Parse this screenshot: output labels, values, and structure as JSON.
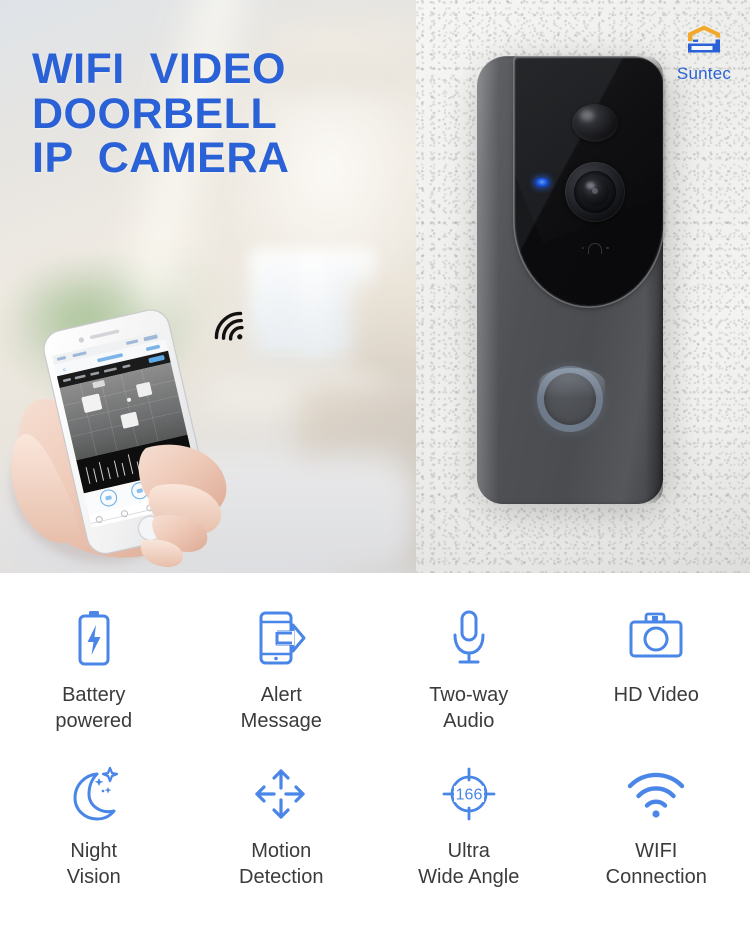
{
  "brand": {
    "name": "Suntec",
    "logo_icon": "house-logo-icon",
    "roof_color": "#f0a92a",
    "base_color": "#2a61d6",
    "text_color": "#2a61d6"
  },
  "hero": {
    "headline_lines": [
      "WIFI  VIDEO",
      "DOORBELL",
      "IP  CAMERA"
    ],
    "headline_color": "#2a61d6",
    "left_scene": {
      "description_icons": [
        "hand-holding-phone",
        "wifi-signal-icon"
      ],
      "wifi_icon": "wifi-signal-icon",
      "phone_icon": "smartphone-app-preview"
    },
    "right_scene": {
      "product_icon": "video-doorbell-device",
      "parts": {
        "pir_sensor": "pir-sensor",
        "camera_lens": "camera-lens",
        "speaker": "speaker-grille",
        "led_indicator": "status-led",
        "doorbell_button": "doorbell-button-ring"
      }
    }
  },
  "features": {
    "icon_color": "#4a86e8",
    "label_color": "#3b3b3b",
    "rows": [
      [
        {
          "icon": "battery-bolt-icon",
          "label": "Battery\npowered"
        },
        {
          "icon": "phone-alert-icon",
          "label": "Alert\nMessage"
        },
        {
          "icon": "microphone-icon",
          "label": "Two-way\nAudio"
        },
        {
          "icon": "camera-icon",
          "label": "HD Video"
        }
      ],
      [
        {
          "icon": "moon-stars-icon",
          "label": "Night\nVision"
        },
        {
          "icon": "four-arrows-icon",
          "label": "Motion\nDetection"
        },
        {
          "icon": "wide-angle-166-icon",
          "label": "Ultra\nWide Angle",
          "value": "166"
        },
        {
          "icon": "wifi-icon",
          "label": "WIFI\nConnection"
        }
      ]
    ]
  }
}
